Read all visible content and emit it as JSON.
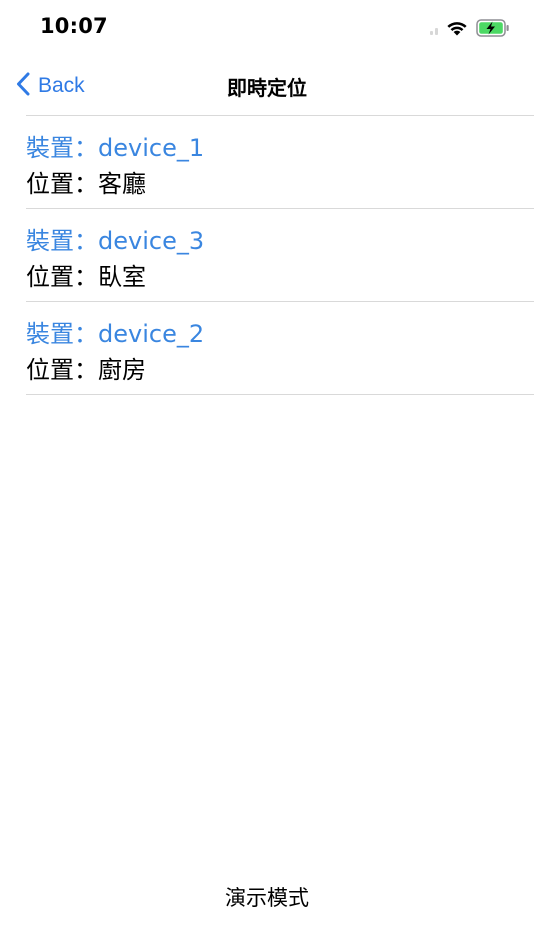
{
  "status_bar": {
    "time": "10:07",
    "icons": [
      "signal-icon",
      "wifi-icon",
      "battery-charging-icon"
    ],
    "battery_color": "#4cd964"
  },
  "nav": {
    "back_label": "Back",
    "title": "即時定位",
    "accent_color": "#2f7ae5"
  },
  "devices": [
    {
      "device_label": "裝置：device_1",
      "location_label": "位置：客廳"
    },
    {
      "device_label": "裝置：device_3",
      "location_label": "位置：臥室"
    },
    {
      "device_label": "裝置：device_2",
      "location_label": "位置：廚房"
    }
  ],
  "footer": {
    "label": "演示模式"
  }
}
